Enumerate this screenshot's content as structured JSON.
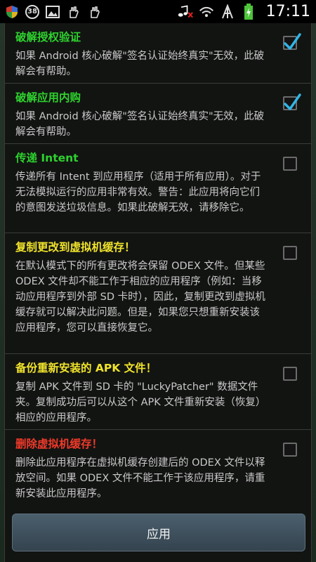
{
  "status_bar": {
    "time": "17:11",
    "badge_count": "38",
    "left_icons": [
      "shield-icon",
      "badge-icon",
      "image-icon",
      "hand-icon",
      "hand-icon"
    ],
    "right_icons": [
      "music-muted-icon",
      "wifi-icon",
      "signal-icon",
      "battery-charging-icon"
    ]
  },
  "options": [
    {
      "title": "破解授权验证",
      "title_color": "#2ed22e",
      "description": "如果 Android 核心破解\"签名认证始终真实\"无效，此破解会有帮助。",
      "checked": true
    },
    {
      "title": "破解应用内购",
      "title_color": "#2ed22e",
      "description": "如果 Android 核心破解\"签名认证始终真实\"无效，此破解会有帮助。",
      "checked": true
    },
    {
      "title": "传递 Intent",
      "title_color": "#2ed22e",
      "description": "传递所有 Intent 到应用程序（适用于所有应用）。对于无法模拟运行的应用非常有效。警告：此应用将向它们的意图发送垃圾信息。如果此破解无效，请移除它。",
      "checked": false
    },
    {
      "title": "复制更改到虚拟机缓存！",
      "title_color": "#f0e32a",
      "description": "在默认模式下的所有更改将会保留 ODEX 文件。但某些 ODEX 文件却不能工作于相应的应用程序（例如：当移动应用程序到外部 SD 卡时），因此，复制更改到虚拟机缓存就可以解决此问题。但是，如果您只想重新安装该应用程序，您可以直接恢复它。",
      "checked": false
    },
    {
      "title": "备份重新安装的 APK 文件！",
      "title_color": "#f0e32a",
      "description": "复制 APK 文件到 SD 卡的 \"LuckyPatcher\" 数据文件夹。复制成功后可以从这个 APK 文件重新安装（恢复）相应的应用程序。",
      "checked": false
    },
    {
      "title": "删除虚拟机缓存！",
      "title_color": "#f03a2a",
      "description": "删除此应用程序在虚拟机缓存创建后的 ODEX 文件以释放空间。如果 ODEX 文件不能工作于该应用程序，请重新安装此应用程序。",
      "checked": false
    }
  ],
  "apply_button": {
    "label": "应用"
  }
}
